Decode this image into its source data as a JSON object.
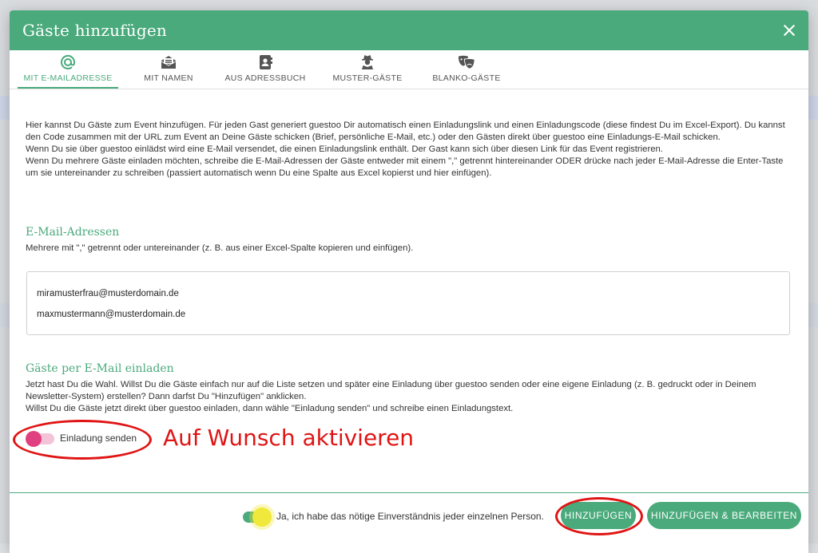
{
  "modal": {
    "title": "Gäste hinzufügen"
  },
  "tabs": [
    {
      "label": "MIT E-MAILADRESSE",
      "icon": "at-icon"
    },
    {
      "label": "MIT NAMEN",
      "icon": "mail-open-icon"
    },
    {
      "label": "AUS ADRESSBUCH",
      "icon": "address-book-icon"
    },
    {
      "label": "MUSTER-GÄSTE",
      "icon": "user-secret-icon"
    },
    {
      "label": "BLANKO-GÄSTE",
      "icon": "theater-masks-icon"
    }
  ],
  "intro": {
    "line1": "Hier kannst Du Gäste zum Event hinzufügen. Für jeden Gast generiert guestoo Dir automatisch einen Einladungslink und einen Einladungscode (diese findest Du im Excel-Export). Du kannst den Code zusammen mit der URL zum Event an Deine Gäste schicken (Brief, persönliche E-Mail, etc.) oder den Gästen direkt über guestoo eine Einladungs-E-Mail schicken.",
    "line2": "Wenn Du sie über guestoo einlädst wird eine E-Mail versendet, die einen Einladungslink enthält. Der Gast kann sich über diesen Link für das Event registrieren.",
    "line3": "Wenn Du mehrere Gäste einladen möchten, schreibe die E-Mail-Adressen der Gäste entweder mit einem \",\" getrennt hintereinander ODER drücke nach jeder E-Mail-Adresse die Enter-Taste um sie untereinander zu schreiben (passiert automatisch wenn Du eine Spalte aus Excel kopierst und hier einfügen)."
  },
  "emails": {
    "title": "E-Mail-Adressen",
    "description": "Mehrere mit \",\" getrennt oder untereinander (z. B. aus einer Excel-Spalte kopieren und einfügen).",
    "values": [
      "miramusterfrau@musterdomain.de",
      "maxmustermann@musterdomain.de"
    ]
  },
  "invite": {
    "title": "Gäste per E-Mail einladen",
    "description1": "Jetzt hast Du die Wahl. Willst Du die Gäste einfach nur auf die Liste setzen und später eine Einladung über guestoo senden oder eine eigene Einladung (z. B. gedruckt oder in Deinem Newsletter-System) erstellen? Dann darfst Du \"Hinzufügen\" anklicken.",
    "description2": "Willst Du die Gäste jetzt direkt über guestoo einladen, dann wähle \"Einladung senden\" und schreibe einen Einladungstext.",
    "toggle_label": "Einladung senden",
    "toggle_on": false
  },
  "annotation": {
    "text": "Auf Wunsch aktivieren"
  },
  "footer": {
    "consent_label": "Ja, ich habe das nötige Einverständnis jeder einzelnen Person.",
    "consent_on": true,
    "add_label": "HINZUFÜGEN",
    "add_edit_label": "HINZUFÜGEN & BEARBEITEN"
  },
  "colors": {
    "primary": "#4aaa7c",
    "toggle_pink": "#e0407f",
    "consent_knob": "#f0e83a",
    "annotation_red": "#e01414"
  }
}
